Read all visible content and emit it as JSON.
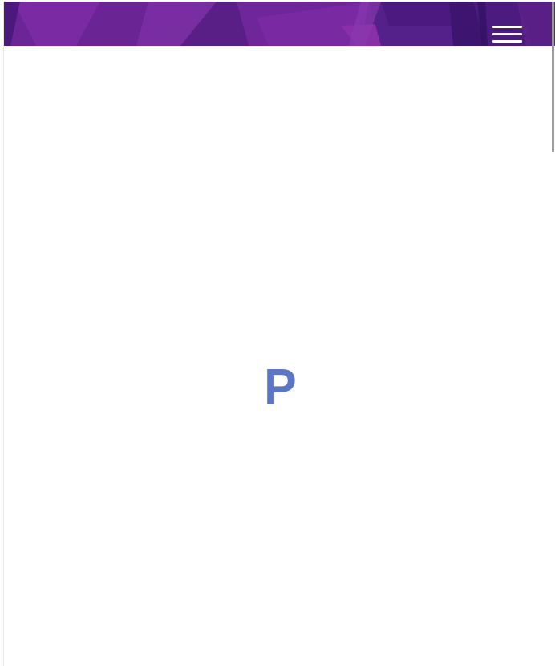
{
  "header": {
    "menu_icon": "hamburger-menu-icon"
  },
  "loader": {
    "letter": "P",
    "color": "#5b76c4"
  },
  "theme": {
    "header_base": "#5a1f86",
    "header_light": "#8a2fa8",
    "header_dark": "#3d1470"
  }
}
